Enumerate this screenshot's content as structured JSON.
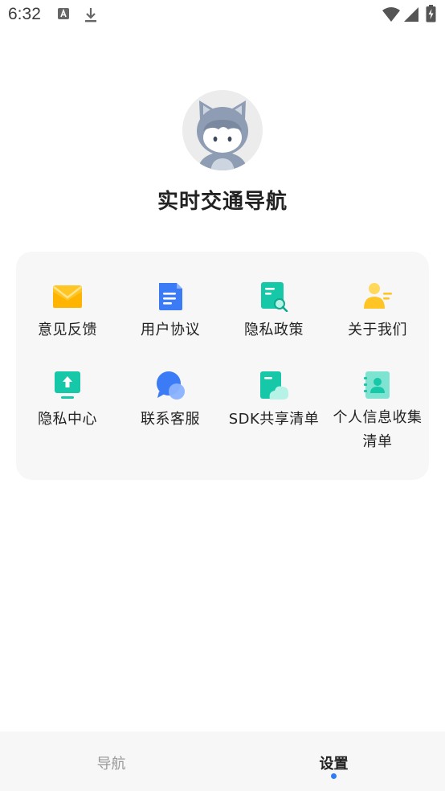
{
  "status_bar": {
    "time": "6:32",
    "icons": [
      "text-a-icon",
      "download-icon",
      "wifi-icon",
      "signal-icon",
      "battery-charging-icon"
    ]
  },
  "profile": {
    "avatar": "avatar-cartoon-icon",
    "app_name": "实时交通导航"
  },
  "menu": {
    "items": [
      {
        "label": "意见反馈",
        "icon": "mail-icon",
        "color": "#FFC524"
      },
      {
        "label": "用户协议",
        "icon": "document-icon",
        "color": "#3B7BF6"
      },
      {
        "label": "隐私政策",
        "icon": "privacy-policy-icon",
        "color": "#16C8A8"
      },
      {
        "label": "关于我们",
        "icon": "about-user-icon",
        "color": "#FFC524"
      },
      {
        "label": "隐私中心",
        "icon": "upload-monitor-icon",
        "color": "#16C8A8"
      },
      {
        "label": "联系客服",
        "icon": "chat-bubble-icon",
        "color": "#3B7BF6"
      },
      {
        "label": "SDK共享清单",
        "icon": "sdk-share-icon",
        "color": "#16C8A8"
      },
      {
        "label": "个人信息收集清单",
        "icon": "contact-book-icon",
        "color": "#7FE3D2"
      }
    ]
  },
  "bottom_nav": {
    "tabs": [
      {
        "label": "导航",
        "active": false
      },
      {
        "label": "设置",
        "active": true
      }
    ],
    "accent": "#2F7CF6"
  }
}
